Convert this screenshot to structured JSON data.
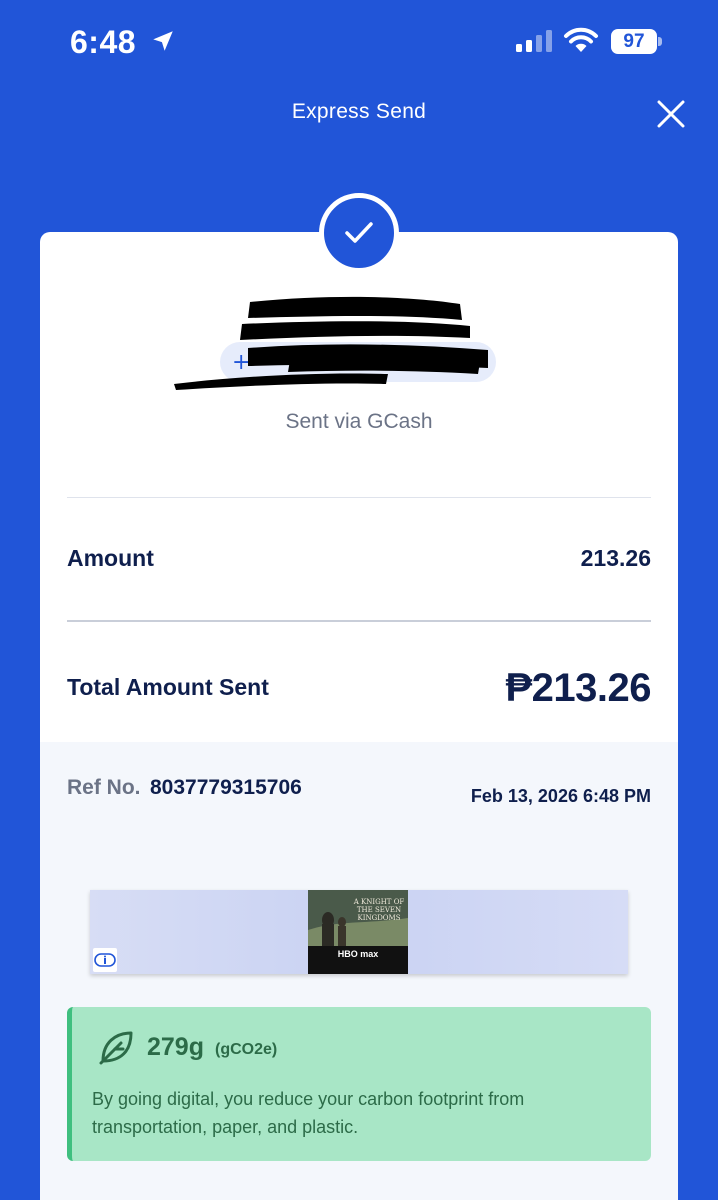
{
  "status_bar": {
    "time": "6:48",
    "battery": "97",
    "icons": [
      "location-arrow-icon",
      "cellular-signal-icon",
      "wifi-icon",
      "battery-icon"
    ]
  },
  "header": {
    "title": "Express Send",
    "close_icon": "close-icon"
  },
  "colors": {
    "brand_blue": "#2155d8",
    "navy_text": "#0f1f4d",
    "muted_text": "#6b7386",
    "eco_bg": "#a8e6c6",
    "eco_text": "#2c6b48"
  },
  "receipt": {
    "success_icon": "check-icon",
    "sent_via": "Sent via GCash",
    "amount_label": "Amount",
    "amount_value": "213.26",
    "total_label": "Total Amount Sent",
    "total_value": "₱213.26"
  },
  "reference": {
    "label": "Ref No.",
    "number": "8037779315706",
    "datetime": "Feb 13, 2026 6:48 PM"
  },
  "ad": {
    "poster_title": "A KNIGHT OF THE SEVEN KINGDOMS",
    "poster_brand": "HBO max",
    "info_icon": "ad-info-icon"
  },
  "eco": {
    "icon": "leaf-icon",
    "value": "279g",
    "unit": "(gCO2e)",
    "message": "By going digital, you reduce your carbon footprint from transportation, paper, and plastic."
  }
}
